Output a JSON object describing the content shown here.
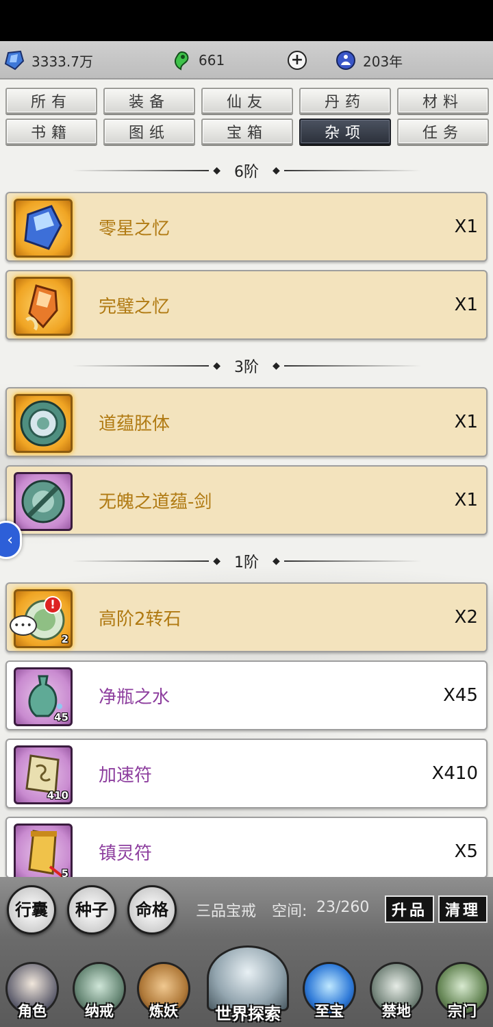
{
  "resources": [
    {
      "icon": "blue-crystal-icon",
      "value": "3333.7万"
    },
    {
      "icon": "green-magatama-icon",
      "value": "661"
    },
    {
      "icon": "meditating-figure-icon",
      "value": "203年"
    }
  ],
  "tabs": [
    {
      "label": "所有",
      "active": false
    },
    {
      "label": "装备",
      "active": false
    },
    {
      "label": "仙友",
      "active": false
    },
    {
      "label": "丹药",
      "active": false
    },
    {
      "label": "材料",
      "active": false
    },
    {
      "label": "书籍",
      "active": false
    },
    {
      "label": "图纸",
      "active": false
    },
    {
      "label": "宝箱",
      "active": false
    },
    {
      "label": "杂项",
      "active": true
    },
    {
      "label": "任务",
      "active": false
    }
  ],
  "sections": [
    {
      "label": "6阶"
    },
    {
      "label": "3阶"
    },
    {
      "label": "1阶"
    }
  ],
  "items": [
    {
      "name": "零星之忆",
      "qty": "X1",
      "rarity": "gold",
      "icon": "crystal-shard-icon",
      "badge": ""
    },
    {
      "name": "完璧之忆",
      "qty": "X1",
      "rarity": "gold",
      "icon": "amber-shard-icon",
      "badge": ""
    },
    {
      "name": "道蕴胚体",
      "qty": "X1",
      "rarity": "gold",
      "icon": "jade-disc-icon",
      "badge": ""
    },
    {
      "name": "无魄之道蕴-剑",
      "qty": "X1",
      "rarity": "purple",
      "icon": "jade-sword-disc-icon",
      "badge": ""
    },
    {
      "name": "高阶2转石",
      "qty": "X2",
      "rarity": "gold",
      "icon": "transform-stone-icon",
      "badge": "2"
    },
    {
      "name": "净瓶之水",
      "qty": "X45",
      "rarity": "purple",
      "icon": "vase-icon",
      "badge": "45"
    },
    {
      "name": "加速符",
      "qty": "X410",
      "rarity": "purple",
      "icon": "talisman-scroll-icon",
      "badge": "410"
    },
    {
      "name": "镇灵符",
      "qty": "X5",
      "rarity": "purple",
      "icon": "golden-scroll-icon",
      "badge": "5"
    }
  ],
  "bag_buttons": [
    "行囊",
    "种子",
    "命格"
  ],
  "ring_info": {
    "name": "三品宝戒",
    "space_label": "空间:",
    "space_value": "23/260"
  },
  "actions": {
    "upgrade": "升品",
    "clean": "清理"
  },
  "nav": [
    {
      "label": "角色",
      "icon": "character-portrait-icon"
    },
    {
      "label": "纳戒",
      "icon": "storage-ring-icon"
    },
    {
      "label": "炼妖",
      "icon": "beast-icon"
    },
    {
      "label": "世界探索",
      "icon": "mountain-icon"
    },
    {
      "label": "至宝",
      "icon": "treasure-orb-icon"
    },
    {
      "label": "禁地",
      "icon": "forbidden-land-icon"
    },
    {
      "label": "宗门",
      "icon": "sect-token-icon"
    }
  ]
}
